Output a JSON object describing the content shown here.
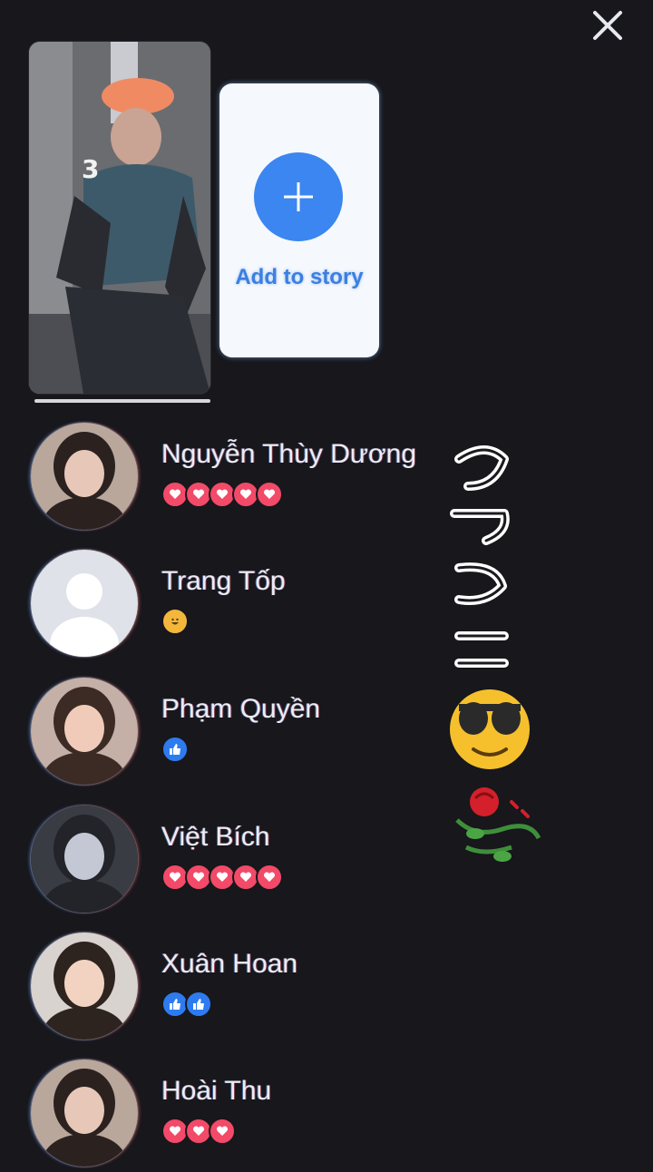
{
  "close": {
    "icon": "close-icon"
  },
  "story": {
    "icon": "story-thumbnail"
  },
  "add_story": {
    "label": "Add to story",
    "icon": "plus-icon"
  },
  "viewers": [
    {
      "name": "Nguyễn Thùy Dương",
      "reactions": [
        "love",
        "love",
        "love",
        "love",
        "love"
      ],
      "avatar": "photo"
    },
    {
      "name": "Trang Tốp",
      "reactions": [
        "haha"
      ],
      "avatar": "default"
    },
    {
      "name": "Phạm Quyền",
      "reactions": [
        "like"
      ],
      "avatar": "photo"
    },
    {
      "name": "Việt Bích",
      "reactions": [
        "love",
        "love",
        "love",
        "love",
        "love"
      ],
      "avatar": "photo"
    },
    {
      "name": "Xuân Hoan",
      "reactions": [
        "like",
        "like"
      ],
      "avatar": "photo"
    },
    {
      "name": "Hoài Thu",
      "reactions": [
        "love",
        "love",
        "love"
      ],
      "avatar": "photo"
    }
  ],
  "colors": {
    "background": "#17171c",
    "accent": "#3b86f0",
    "love": "#f24a68",
    "like": "#2e7bf0"
  }
}
